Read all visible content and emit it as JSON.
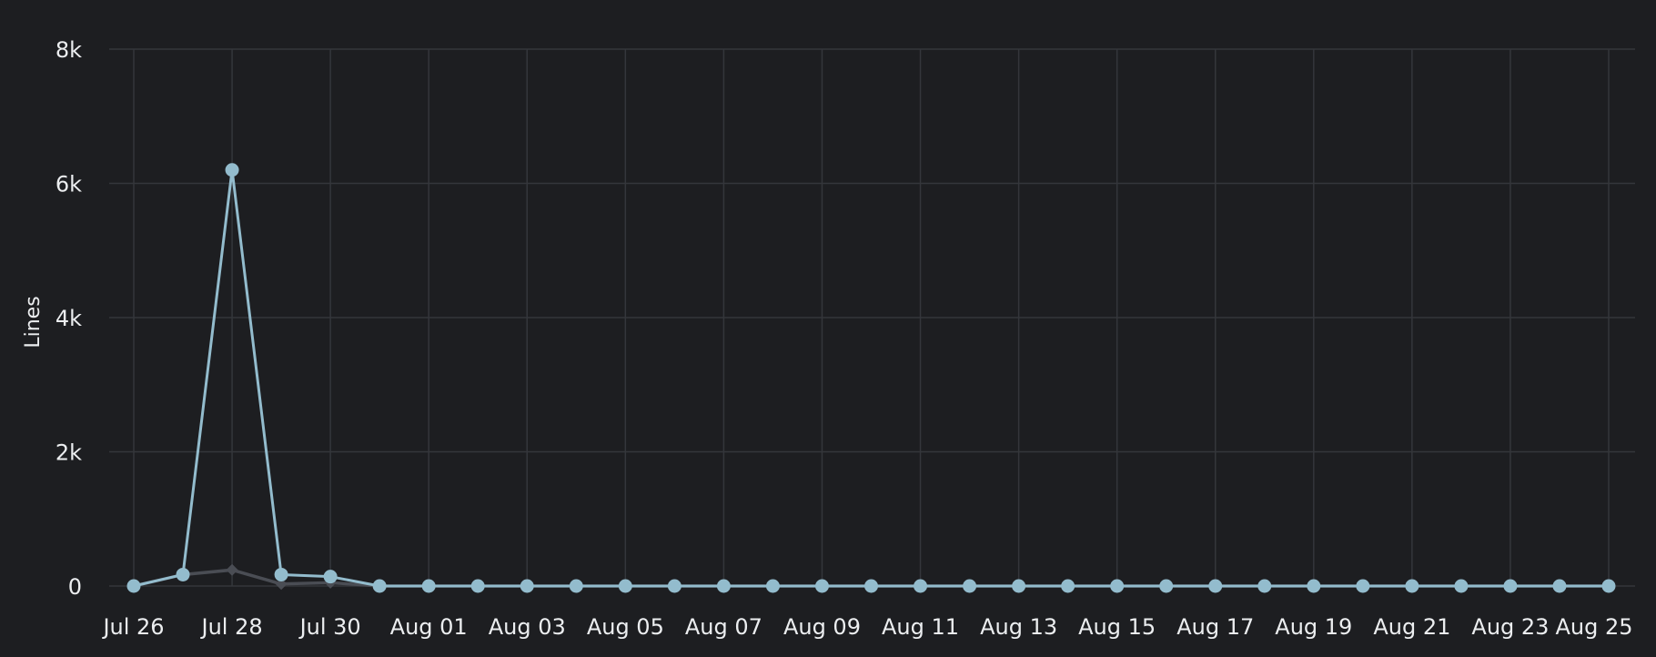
{
  "chart_data": {
    "type": "line",
    "title": "",
    "xlabel": "",
    "ylabel": "Lines",
    "x": [
      "Jul 26",
      "Jul 27",
      "Jul 28",
      "Jul 29",
      "Jul 30",
      "Jul 31",
      "Aug 01",
      "Aug 02",
      "Aug 03",
      "Aug 04",
      "Aug 05",
      "Aug 06",
      "Aug 07",
      "Aug 08",
      "Aug 09",
      "Aug 10",
      "Aug 11",
      "Aug 12",
      "Aug 13",
      "Aug 14",
      "Aug 15",
      "Aug 16",
      "Aug 17",
      "Aug 18",
      "Aug 19",
      "Aug 20",
      "Aug 21",
      "Aug 22",
      "Aug 23",
      "Aug 24",
      "Aug 25"
    ],
    "x_tick_labels": [
      "Jul 26",
      "Jul 28",
      "Jul 30",
      "Aug 01",
      "Aug 03",
      "Aug 05",
      "Aug 07",
      "Aug 09",
      "Aug 11",
      "Aug 13",
      "Aug 15",
      "Aug 17",
      "Aug 19",
      "Aug 21",
      "Aug 23",
      "Aug 25"
    ],
    "ylim": [
      0,
      8000
    ],
    "y_ticks": [
      0,
      2000,
      4000,
      6000,
      8000
    ],
    "y_tick_labels": [
      "0",
      "2k",
      "4k",
      "6k",
      "8k"
    ],
    "grid": true,
    "series": [
      {
        "marker": "circle",
        "color": "#93bccd",
        "values": [
          0,
          170,
          6200,
          170,
          140,
          0,
          0,
          0,
          0,
          0,
          0,
          0,
          0,
          0,
          0,
          0,
          0,
          0,
          0,
          0,
          0,
          0,
          0,
          0,
          0,
          0,
          0,
          0,
          0,
          0,
          0
        ]
      },
      {
        "marker": "diamond",
        "color": "#4a4d54",
        "values": [
          0,
          170,
          240,
          30,
          50,
          0,
          0,
          0,
          0,
          0,
          0,
          0,
          0,
          0,
          0,
          0,
          0,
          0,
          0,
          0,
          0,
          0,
          0,
          0,
          0,
          0,
          0,
          0,
          0,
          0,
          0
        ]
      }
    ]
  }
}
